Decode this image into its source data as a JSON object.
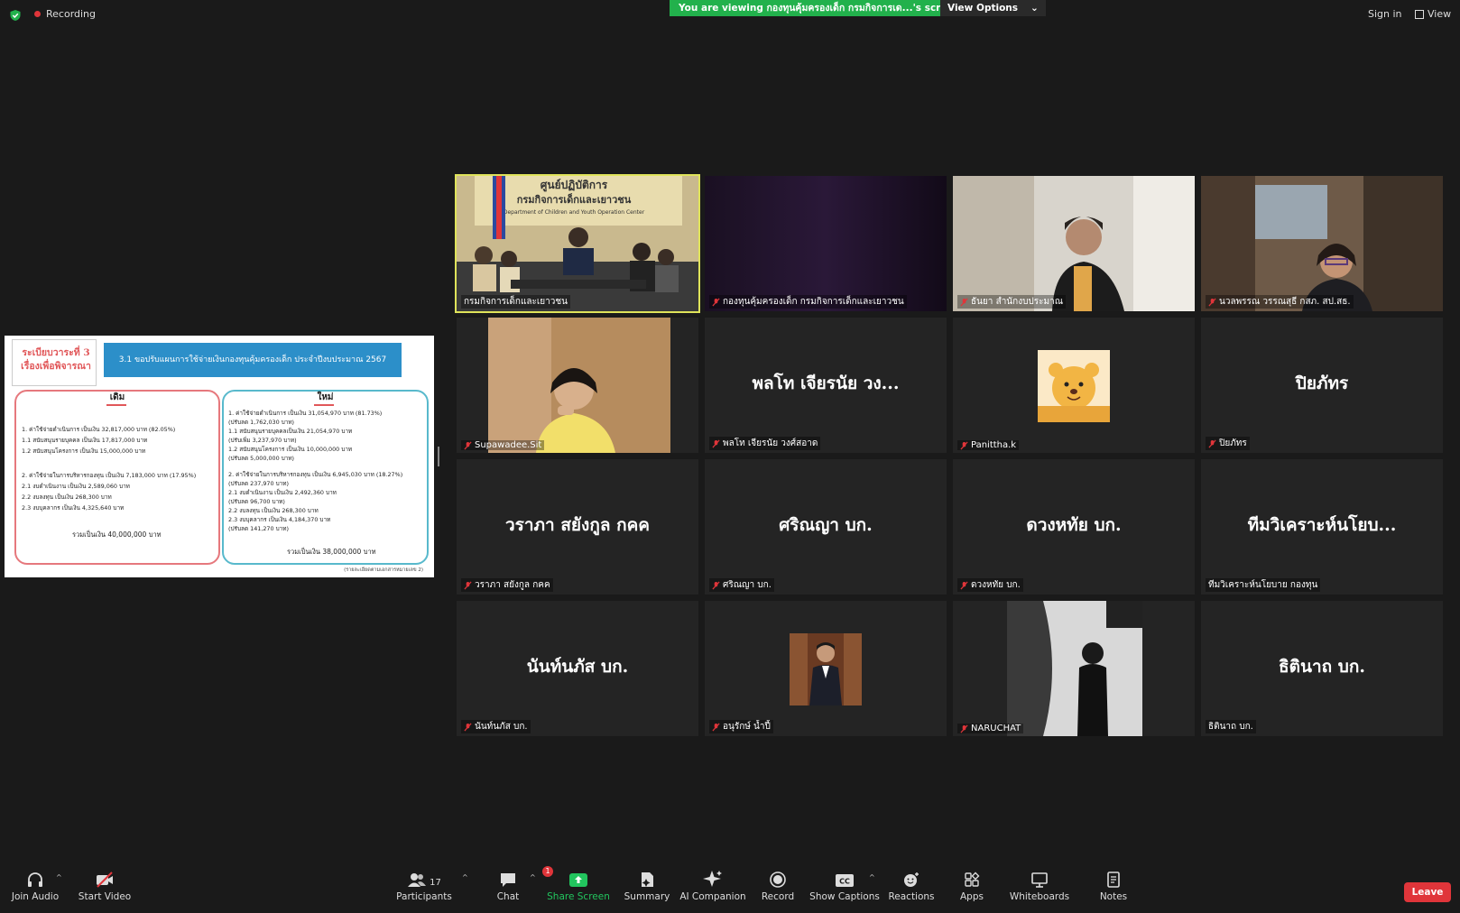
{
  "topbar": {
    "recording_label": "Recording",
    "viewing_banner": "You are viewing กองทุนคุ้มครองเด็ก กรมกิจการเด...'s screen",
    "view_options": "View Options",
    "sign_in": "Sign in",
    "view": "View"
  },
  "slide": {
    "agenda_line1": "ระเบียบวาระที่ 3",
    "agenda_line2": "เรื่องเพื่อพิจารณา",
    "title": "3.1 ขอปรับแผนการใช้จ่ายเงินกองทุนคุ้มครองเด็ก ประจำปีงบประมาณ 2567",
    "old_heading": "เดิม",
    "new_heading": "ใหม่",
    "old_lines": [
      "1. ค่าใช้จ่ายดำเนินการ                เป็นเงิน  32,817,000 บาท (82.05%)",
      "    1.1 สนับสนุนรายบุคคล           เป็นเงิน 17,817,000 บาท",
      "    1.2  สนับสนุนโครงการ            เป็นเงิน 15,000,000 บาท",
      "2. ค่าใช้จ่ายในการบริหารกองทุน   เป็นเงิน  7,183,000  บาท (17.95%)",
      "    2.1 งบดำเนินงาน                   เป็นเงิน 2,589,060 บาท",
      "    2.2 งบลงทุน                         เป็นเงิน 268,300 บาท",
      "    2.3 งบบุคลากร                      เป็นเงิน 4,325,640 บาท"
    ],
    "old_total": "รวมเป็นเงิน 40,000,000 บาท",
    "new_lines": [
      "1. ค่าใช้จ่ายดำเนินการ เป็นเงิน  31,054,970 บาท (81.73%)",
      "    (ปรับลด 1,762,030 บาท)",
      "    1.1 สนับสนุนรายบุคคลเป็นเงิน 21,054,970 บาท",
      "         (ปรับเพิ่ม 3,237,970 บาท)",
      "    1.2 สนับสนุนโครงการ เป็นเงิน 10,000,000 บาท",
      "         (ปรับลด 5,000,000 บาท)",
      "2. ค่าใช้จ่ายในการบริหารกองทุน เป็นเงิน 6,945,030 บาท (18.27%)",
      "    (ปรับลด 237,970 บาท)",
      "    2.1 งบดำเนินงาน เป็นเงิน 2,492,360 บาท",
      "         (ปรับลด 96,700 บาท)",
      "    2.2 งบลงทุน เป็นเงิน 268,300 บาท",
      "    2.3 งบบุคลากร เป็นเงิน 4,184,370 บาท",
      "         (ปรับลด 141,270 บาท)"
    ],
    "new_total": "รวมเป็นเงิน 38,000,000 บาท",
    "footnote": "(รายละเอียดตามเอกสารหมายเลข 2)"
  },
  "tiles": [
    {
      "label": "กรมกิจการเด็กและเยาวชน",
      "big_name": "",
      "video": "conference-room",
      "active": true,
      "muted": false
    },
    {
      "label": "กองทุนคุ้มครองเด็ก กรมกิจการเด็กและเยาวชน",
      "big_name": "",
      "video": "dark-curtain",
      "active": false,
      "muted": true
    },
    {
      "label": "ธันยา สำนักงบประมาณ",
      "big_name": "",
      "video": "woman-glasses",
      "active": false,
      "muted": true
    },
    {
      "label": "นวลพรรณ วรรณสุธี กสภ. สป.สธ.",
      "big_name": "",
      "video": "woman-office",
      "active": false,
      "muted": true
    },
    {
      "label": "Supawadee.Sit",
      "big_name": "",
      "video": "woman-yellow",
      "active": false,
      "muted": true
    },
    {
      "label": "พลโท เจียรนัย วงศ์สอาด",
      "big_name": "พลโท เจียรนัย วง...",
      "video": "",
      "active": false,
      "muted": true
    },
    {
      "label": "Panittha.k",
      "big_name": "",
      "video": "pooh-avatar",
      "active": false,
      "muted": true
    },
    {
      "label": "ปิยภัทร",
      "big_name": "ปิยภัทร",
      "video": "",
      "active": false,
      "muted": true
    },
    {
      "label": "วราภา สยังกูล กคค",
      "big_name": "วราภา สยังกูล กคค",
      "video": "",
      "active": false,
      "muted": true
    },
    {
      "label": "ศริณญา บก.",
      "big_name": "ศริณญา บก.",
      "video": "",
      "active": false,
      "muted": true
    },
    {
      "label": "ดวงหทัย บก.",
      "big_name": "ดวงหทัย บก.",
      "video": "",
      "active": false,
      "muted": true
    },
    {
      "label": "ทีมวิเคราะห์นโยบาย กองทุน",
      "big_name": "ทีมวิเคราะห์นโยบ...",
      "video": "",
      "active": false,
      "muted": false
    },
    {
      "label": "นันท์นภัส บก.",
      "big_name": "นันท์นภัส บก.",
      "video": "",
      "active": false,
      "muted": true
    },
    {
      "label": "อนุรักษ์ น้ำปี้",
      "big_name": "",
      "video": "man-suit-avatar",
      "active": false,
      "muted": true
    },
    {
      "label": "NARUCHAT",
      "big_name": "",
      "video": "bw-gallery",
      "active": false,
      "muted": true
    },
    {
      "label": "ธิตินาถ บก.",
      "big_name": "ธิตินาถ บก.",
      "video": "",
      "active": false,
      "muted": false
    }
  ],
  "toolbar": {
    "join_audio": "Join Audio",
    "start_video": "Start Video",
    "participants": "Participants",
    "participants_count": "17",
    "chat": "Chat",
    "chat_badge": "1",
    "share_screen": "Share Screen",
    "summary": "Summary",
    "ai_companion": "AI Companion",
    "record": "Record",
    "show_captions": "Show Captions",
    "reactions": "Reactions",
    "apps": "Apps",
    "whiteboards": "Whiteboards",
    "notes": "Notes",
    "leave": "Leave"
  },
  "colors": {
    "banner_green": "#22b14c",
    "leave_red": "#e0353a",
    "active_speaker": "#dfe35a",
    "share_green": "#22c55e"
  }
}
